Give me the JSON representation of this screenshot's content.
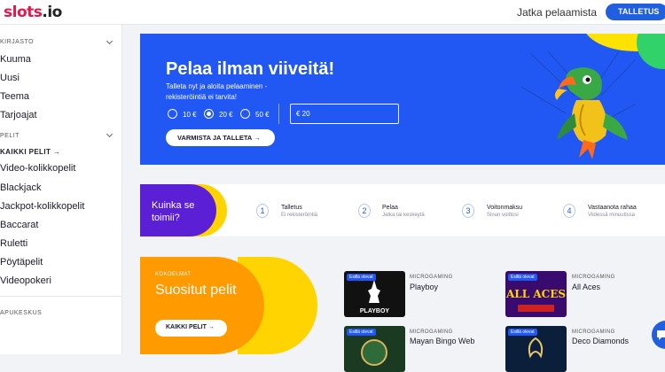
{
  "header": {
    "logo": "slots",
    "logo_suffix": ".io",
    "continue_label": "Jatka pelaamista",
    "deposit_label": "TALLETUS"
  },
  "sidebar": {
    "library_label": "KIRJASTO",
    "library_items": [
      "Kuuma",
      "Uusi",
      "Teema",
      "Tarjoajat"
    ],
    "games_label": "PELIT",
    "all_games_label": "KAIKKI PELIT →",
    "game_items": [
      "Video-kolikkopelit",
      "Blackjack",
      "Jackpot-kolikkopelit",
      "Baccarat",
      "Ruletti",
      "Pöytäpelit",
      "Videopokeri"
    ],
    "help_label": "APUKESKUS"
  },
  "hero": {
    "title": "Pelaa ilman viiveitä!",
    "subtitle": "Talleta nyt ja aloita pelaaminen - rekisteröintiä ei tarvita!",
    "options": [
      {
        "label": "10 €",
        "selected": false
      },
      {
        "label": "20 €",
        "selected": true
      },
      {
        "label": "50 €",
        "selected": false
      }
    ],
    "amount": "€  20",
    "button_label": "VARMISTA JA TALLETA  →"
  },
  "how": {
    "title": "Kuinka se toimii?",
    "steps": [
      {
        "num": "1",
        "title": "Talletus",
        "desc": "Ei rekisteröintiä"
      },
      {
        "num": "2",
        "title": "Pelaa",
        "desc": "Jatka tai keskeytä"
      },
      {
        "num": "3",
        "title": "Voitonmaksu",
        "desc": "Sinun voittosi"
      },
      {
        "num": "4",
        "title": "Vastaanota rahaa",
        "desc": "Viidessä minuutissa"
      }
    ]
  },
  "collections": {
    "label": "KOKOELMAT",
    "title": "Suositut pelit",
    "button_label": "KAIKKI PELIT  →"
  },
  "games": [
    {
      "badge": "Esillä olevat",
      "provider": "MICROGAMING",
      "name": "Playboy",
      "thumb_text": "PLAYBOY",
      "color": "#111111"
    },
    {
      "badge": "Esillä olevat",
      "provider": "MICROGAMING",
      "name": "All Aces",
      "thumb_text": "ALL ACES",
      "color": "#3a0b6e"
    },
    {
      "badge": "Esillä olevat",
      "provider": "MICROGAMING",
      "name": "Mayan Bingo Web",
      "thumb_text": "",
      "color": "#1a3a22"
    },
    {
      "badge": "Esillä olevat",
      "provider": "MICROGAMING",
      "name": "Deco Diamonds",
      "thumb_text": "",
      "color": "#0b1e3a"
    }
  ],
  "colors": {
    "accent": "#2157f2",
    "brand": "#e6184b",
    "purple": "#5b1fd6",
    "yellow": "#ffd400",
    "orange": "#ff9a00"
  }
}
